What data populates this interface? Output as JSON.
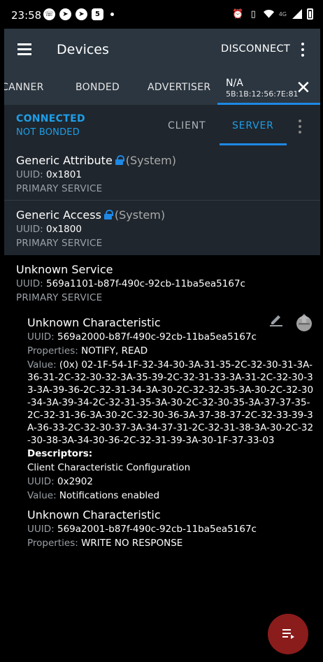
{
  "status_bar": {
    "time": "23:58",
    "network": "4G",
    "left_icons": [
      "viber-icon",
      "telegram-icon",
      "telegram-icon",
      "app-icon"
    ],
    "right_icons": [
      "alarm-icon",
      "vibrate-icon",
      "wifi-icon",
      "signal-icon",
      "battery-icon"
    ]
  },
  "toolbar": {
    "title": "Devices",
    "disconnect_label": "DISCONNECT"
  },
  "tabs": {
    "items": [
      "CANNER",
      "BONDED",
      "ADVERTISER"
    ],
    "active_device_name": "N/A",
    "active_device_mac": "5B:1B:12:56:7E:81"
  },
  "connection": {
    "state": "CONNECTED",
    "bond": "NOT BONDED"
  },
  "role_tabs": {
    "client": "CLIENT",
    "server": "SERVER",
    "active": "SERVER"
  },
  "labels": {
    "uuid": "UUID:",
    "properties": "Properties:",
    "value": "Value:",
    "descriptors": "Descriptors:"
  },
  "services": [
    {
      "name": "Generic Attribute",
      "system": "(System)",
      "uuid": "0x1801",
      "type": "PRIMARY SERVICE"
    },
    {
      "name": "Generic Access",
      "system": "(System)",
      "uuid": "0x1800",
      "type": "PRIMARY SERVICE"
    },
    {
      "name": "Unknown Service",
      "uuid": "569a1101-b87f-490c-92cb-11ba5ea5167c",
      "type": "PRIMARY SERVICE"
    }
  ],
  "characteristics": [
    {
      "name": "Unknown Characteristic",
      "uuid": "569a2000-b87f-490c-92cb-11ba5ea5167c",
      "properties": "NOTIFY, READ",
      "value": "(0x) 02-1F-54-1F-32-34-30-3A-31-35-2C-32-30-31-3A-36-31-2C-32-30-32-3A-35-39-2C-32-31-33-3A-31-2C-32-30-33-3A-39-36-2C-32-31-34-3A-30-2C-32-32-35-3A-30-2C-32-30-34-3A-39-34-2C-32-31-35-3A-30-2C-32-30-35-3A-37-37-35-2C-32-31-36-3A-30-2C-32-30-36-3A-37-38-37-2C-32-33-39-3A-36-33-2C-32-30-37-3A-34-37-31-2C-32-31-38-3A-30-2C-32-30-38-3A-34-30-36-2C-32-31-39-3A-30-1F-37-33-03",
      "descriptor": {
        "name": "Client Characteristic Configuration",
        "uuid": "0x2902",
        "value": "Notifications enabled"
      }
    },
    {
      "name": "Unknown Characteristic",
      "uuid": "569a2001-b87f-490c-92cb-11ba5ea5167c",
      "properties": "WRITE NO RESPONSE"
    }
  ],
  "colors": {
    "accent": "#1e88e5",
    "connected_text": "#1e9ee8",
    "toolbar": "#2b3640",
    "card": "#1f262d",
    "fab": "#8b1c1c"
  }
}
